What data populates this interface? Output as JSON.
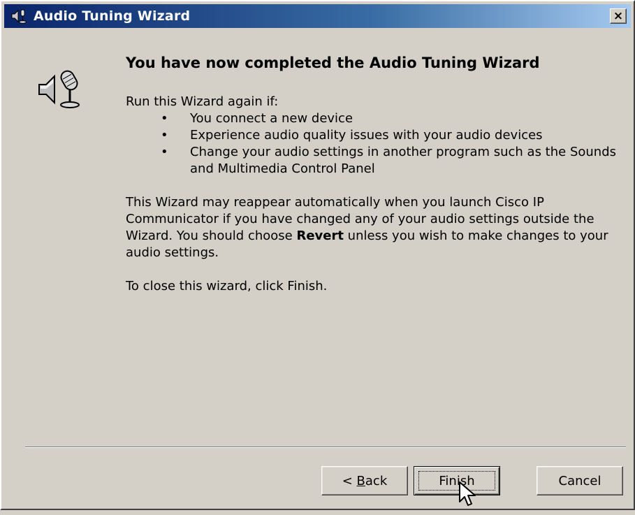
{
  "window": {
    "title": "Audio Tuning Wizard",
    "close_glyph": "×"
  },
  "main": {
    "heading": "You have now completed the Audio Tuning Wizard",
    "intro": "Run this Wizard again if:",
    "bullets": [
      "You connect a new device",
      "Experience audio quality issues with your audio devices",
      "Change your audio settings in another program such as the Sounds and Multimedia Control Panel"
    ],
    "bullet_glyph": "•",
    "para2_before": "This Wizard may reappear automatically when you launch Cisco IP Communicator if you have changed any of your audio settings outside the Wizard. You should choose ",
    "para2_bold": "Revert",
    "para2_after": " unless you wish to make changes to your audio settings.",
    "para3": "To close this wizard, click Finish."
  },
  "buttons": {
    "back_prefix": "< ",
    "back_accel": "B",
    "back_rest": "ack",
    "finish": "Finish",
    "cancel": "Cancel"
  },
  "icons": {
    "title_icon": "speaker-microphone-icon",
    "wizard_icon": "speaker-microphone-icon",
    "cursor": "mouse-pointer-icon"
  },
  "colors": {
    "titlebar_start": "#0a246a",
    "titlebar_end": "#a6caf0",
    "dialog_bg": "#d4d0c8"
  }
}
